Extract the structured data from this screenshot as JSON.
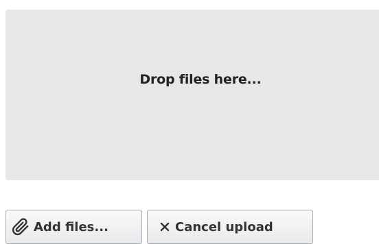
{
  "dropzone": {
    "text": "Drop files here..."
  },
  "buttons": {
    "add_files": {
      "label": "Add files...",
      "icon": "paperclip-icon"
    },
    "cancel_upload": {
      "label": "Cancel upload",
      "icon": "close-icon"
    }
  },
  "colors": {
    "dropzone_background": "#e6e7e9",
    "button_border": "#a9acb1",
    "text": "#222222"
  }
}
